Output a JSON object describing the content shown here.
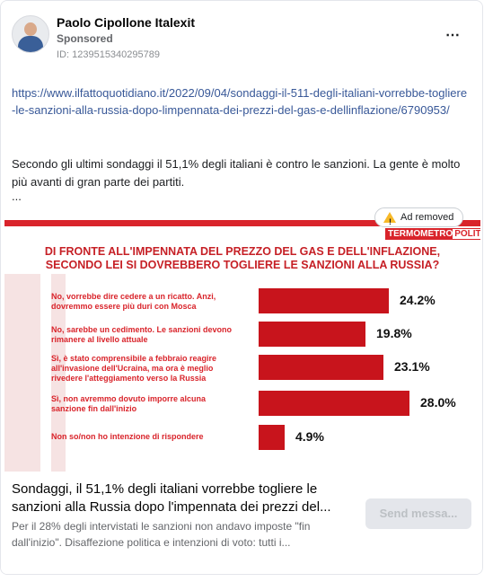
{
  "post": {
    "author": "Paolo Cipollone Italexit",
    "sponsored": "Sponsored",
    "id_line": "ID: 1239515340295789",
    "link": "https://www.ilfattoquotidiano.it/2022/09/04/sondaggi-il-511-degli-italiani-vorrebbe-togliere-le-sanzioni-alla-russia-dopo-limpennata-dei-prezzi-del-gas-e-dellinflazione/6790953/",
    "text": "Secondo gli ultimi sondaggi il 51,1% degli italiani è contro le sanzioni. La gente è molto più avanti di gran parte dei partiti.",
    "ellipsis": "...",
    "more_icon": "⋯"
  },
  "figure": {
    "brand_a": "TERMOMETRO",
    "brand_b": "POLITICO",
    "ad_removed": "Ad removed",
    "title_line1": "DI FRONTE ALL'IMPENNATA DEL PREZZO DEL GAS E DELL'INFLAZIONE,",
    "title_line2": "SECONDO LEI SI DOVREBBERO TOGLIERE LE SANZIONI ALLA RUSSIA?",
    "rows": [
      {
        "label": "No, vorrebbe dire cedere a un ricatto. Anzi, dovremmo essere più duri con Mosca",
        "value_text": "24.2%",
        "value": 24.2
      },
      {
        "label": "No, sarebbe un cedimento. Le sanzioni devono rimanere al livello attuale",
        "value_text": "19.8%",
        "value": 19.8
      },
      {
        "label": "Sì, è stato comprensibile a febbraio reagire all'invasione dell'Ucraina, ma ora è meglio rivedere l'atteggiamento verso la Russia",
        "value_text": "23.1%",
        "value": 23.1
      },
      {
        "label": "Sì, non avremmo dovuto imporre alcuna sanzione fin dall'inizio",
        "value_text": "28.0%",
        "value": 28.0
      },
      {
        "label": "Non so/non ho intenzione di rispondere",
        "value_text": "4.9%",
        "value": 4.9
      }
    ]
  },
  "footer": {
    "headline": "Sondaggi, il 51,1% degli italiani vorrebbe togliere le sanzioni alla Russia dopo l'impennata dei prezzi del...",
    "description": "Per il 28% degli intervistati le sanzioni non andavo imposte \"fin dall'inizio\". Disaffezione politica e intenzioni di voto: tutti i...",
    "cta": "Send messa..."
  },
  "colors": {
    "accent": "#c8141c",
    "link": "#385898"
  }
}
